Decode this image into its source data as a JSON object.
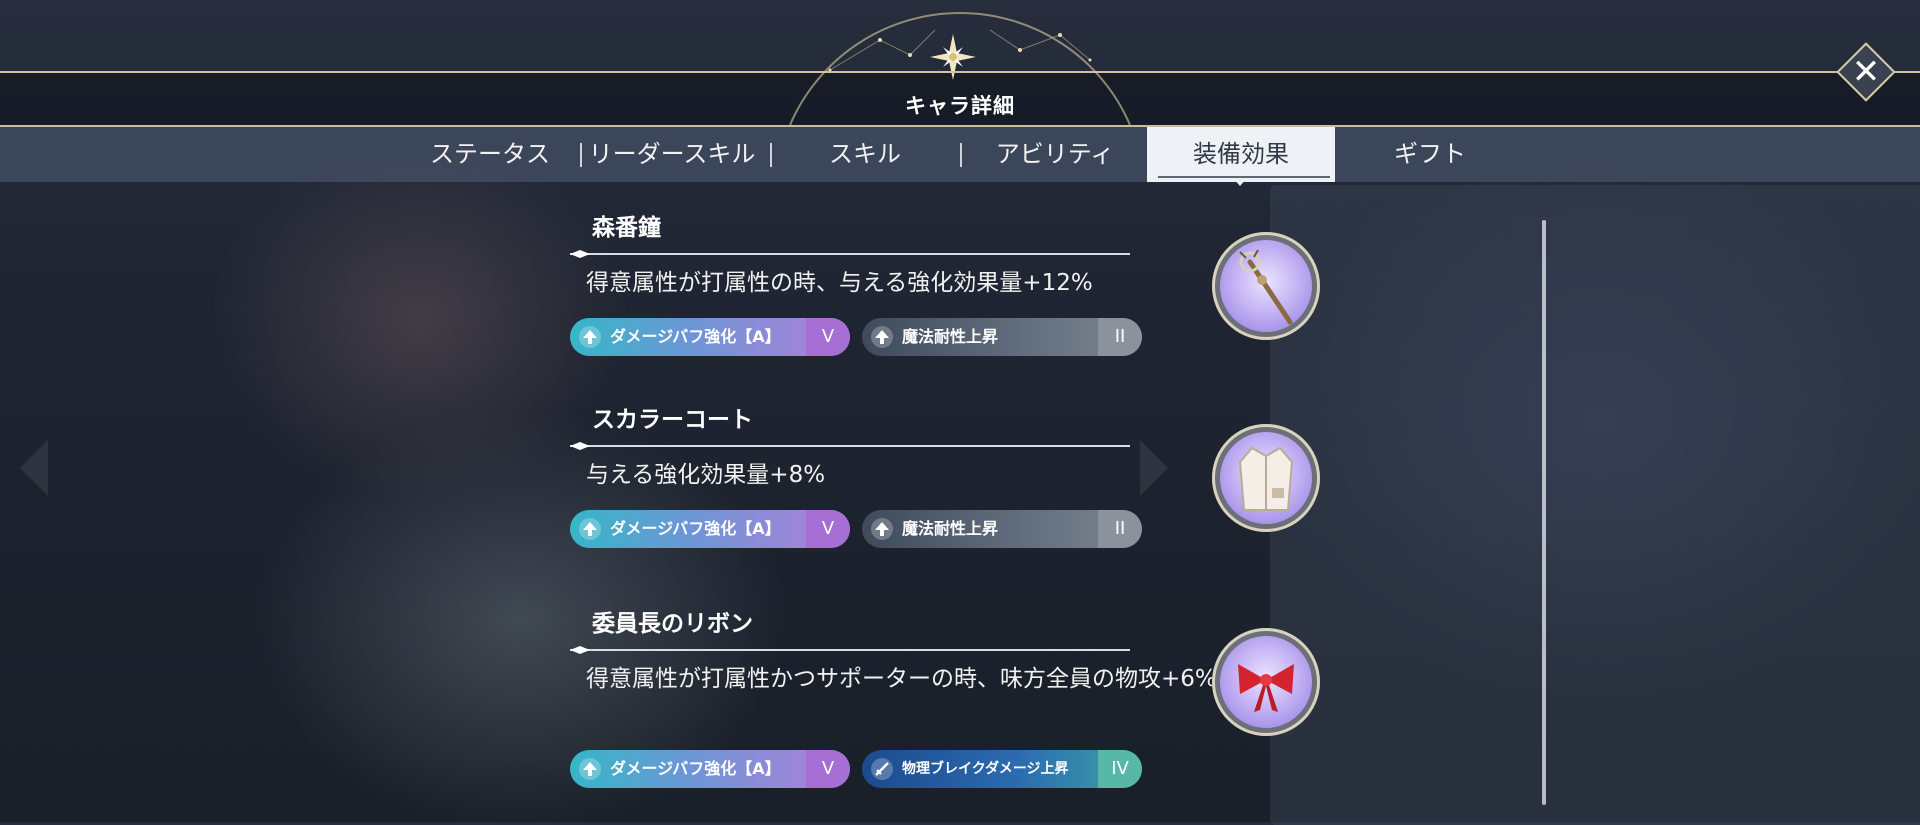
{
  "window": {
    "title": "キャラ詳細"
  },
  "tabs": [
    {
      "label": "ステータス",
      "active": false
    },
    {
      "label": "リーダースキル",
      "active": false
    },
    {
      "label": "スキル",
      "active": false
    },
    {
      "label": "アビリティ",
      "active": false
    },
    {
      "label": "装備効果",
      "active": true
    },
    {
      "label": "ギフト",
      "active": false
    }
  ],
  "equipment": [
    {
      "name": "森番鐘",
      "description": "得意属性が打属性の時、与える強化効果量+12%",
      "icon": "staff-bell-icon",
      "badges": [
        {
          "label": "ダメージバフ強化【A】",
          "level": "V",
          "type": "buff"
        },
        {
          "label": "魔法耐性上昇",
          "level": "II",
          "type": "resist"
        }
      ]
    },
    {
      "name": "スカラーコート",
      "description": "与える強化効果量+8%",
      "icon": "coat-icon",
      "badges": [
        {
          "label": "ダメージバフ強化【A】",
          "level": "V",
          "type": "buff"
        },
        {
          "label": "魔法耐性上昇",
          "level": "II",
          "type": "resist"
        }
      ]
    },
    {
      "name": "委員長のリボン",
      "description": "得意属性が打属性かつサポーターの時、味方全員の物攻+6%",
      "icon": "ribbon-icon",
      "badges": [
        {
          "label": "ダメージバフ強化【A】",
          "level": "V",
          "type": "buff"
        },
        {
          "label": "物理ブレイクダメージ上昇",
          "level": "IV",
          "type": "phys"
        }
      ]
    }
  ],
  "icons": {
    "close": "close-icon",
    "title_emblem": "star-emblem-icon"
  },
  "colors": {
    "accent_gold": "#cfc3a1",
    "buff_gradient_end": "#b37ed9",
    "buff_gradient_start": "#36b6c7"
  }
}
